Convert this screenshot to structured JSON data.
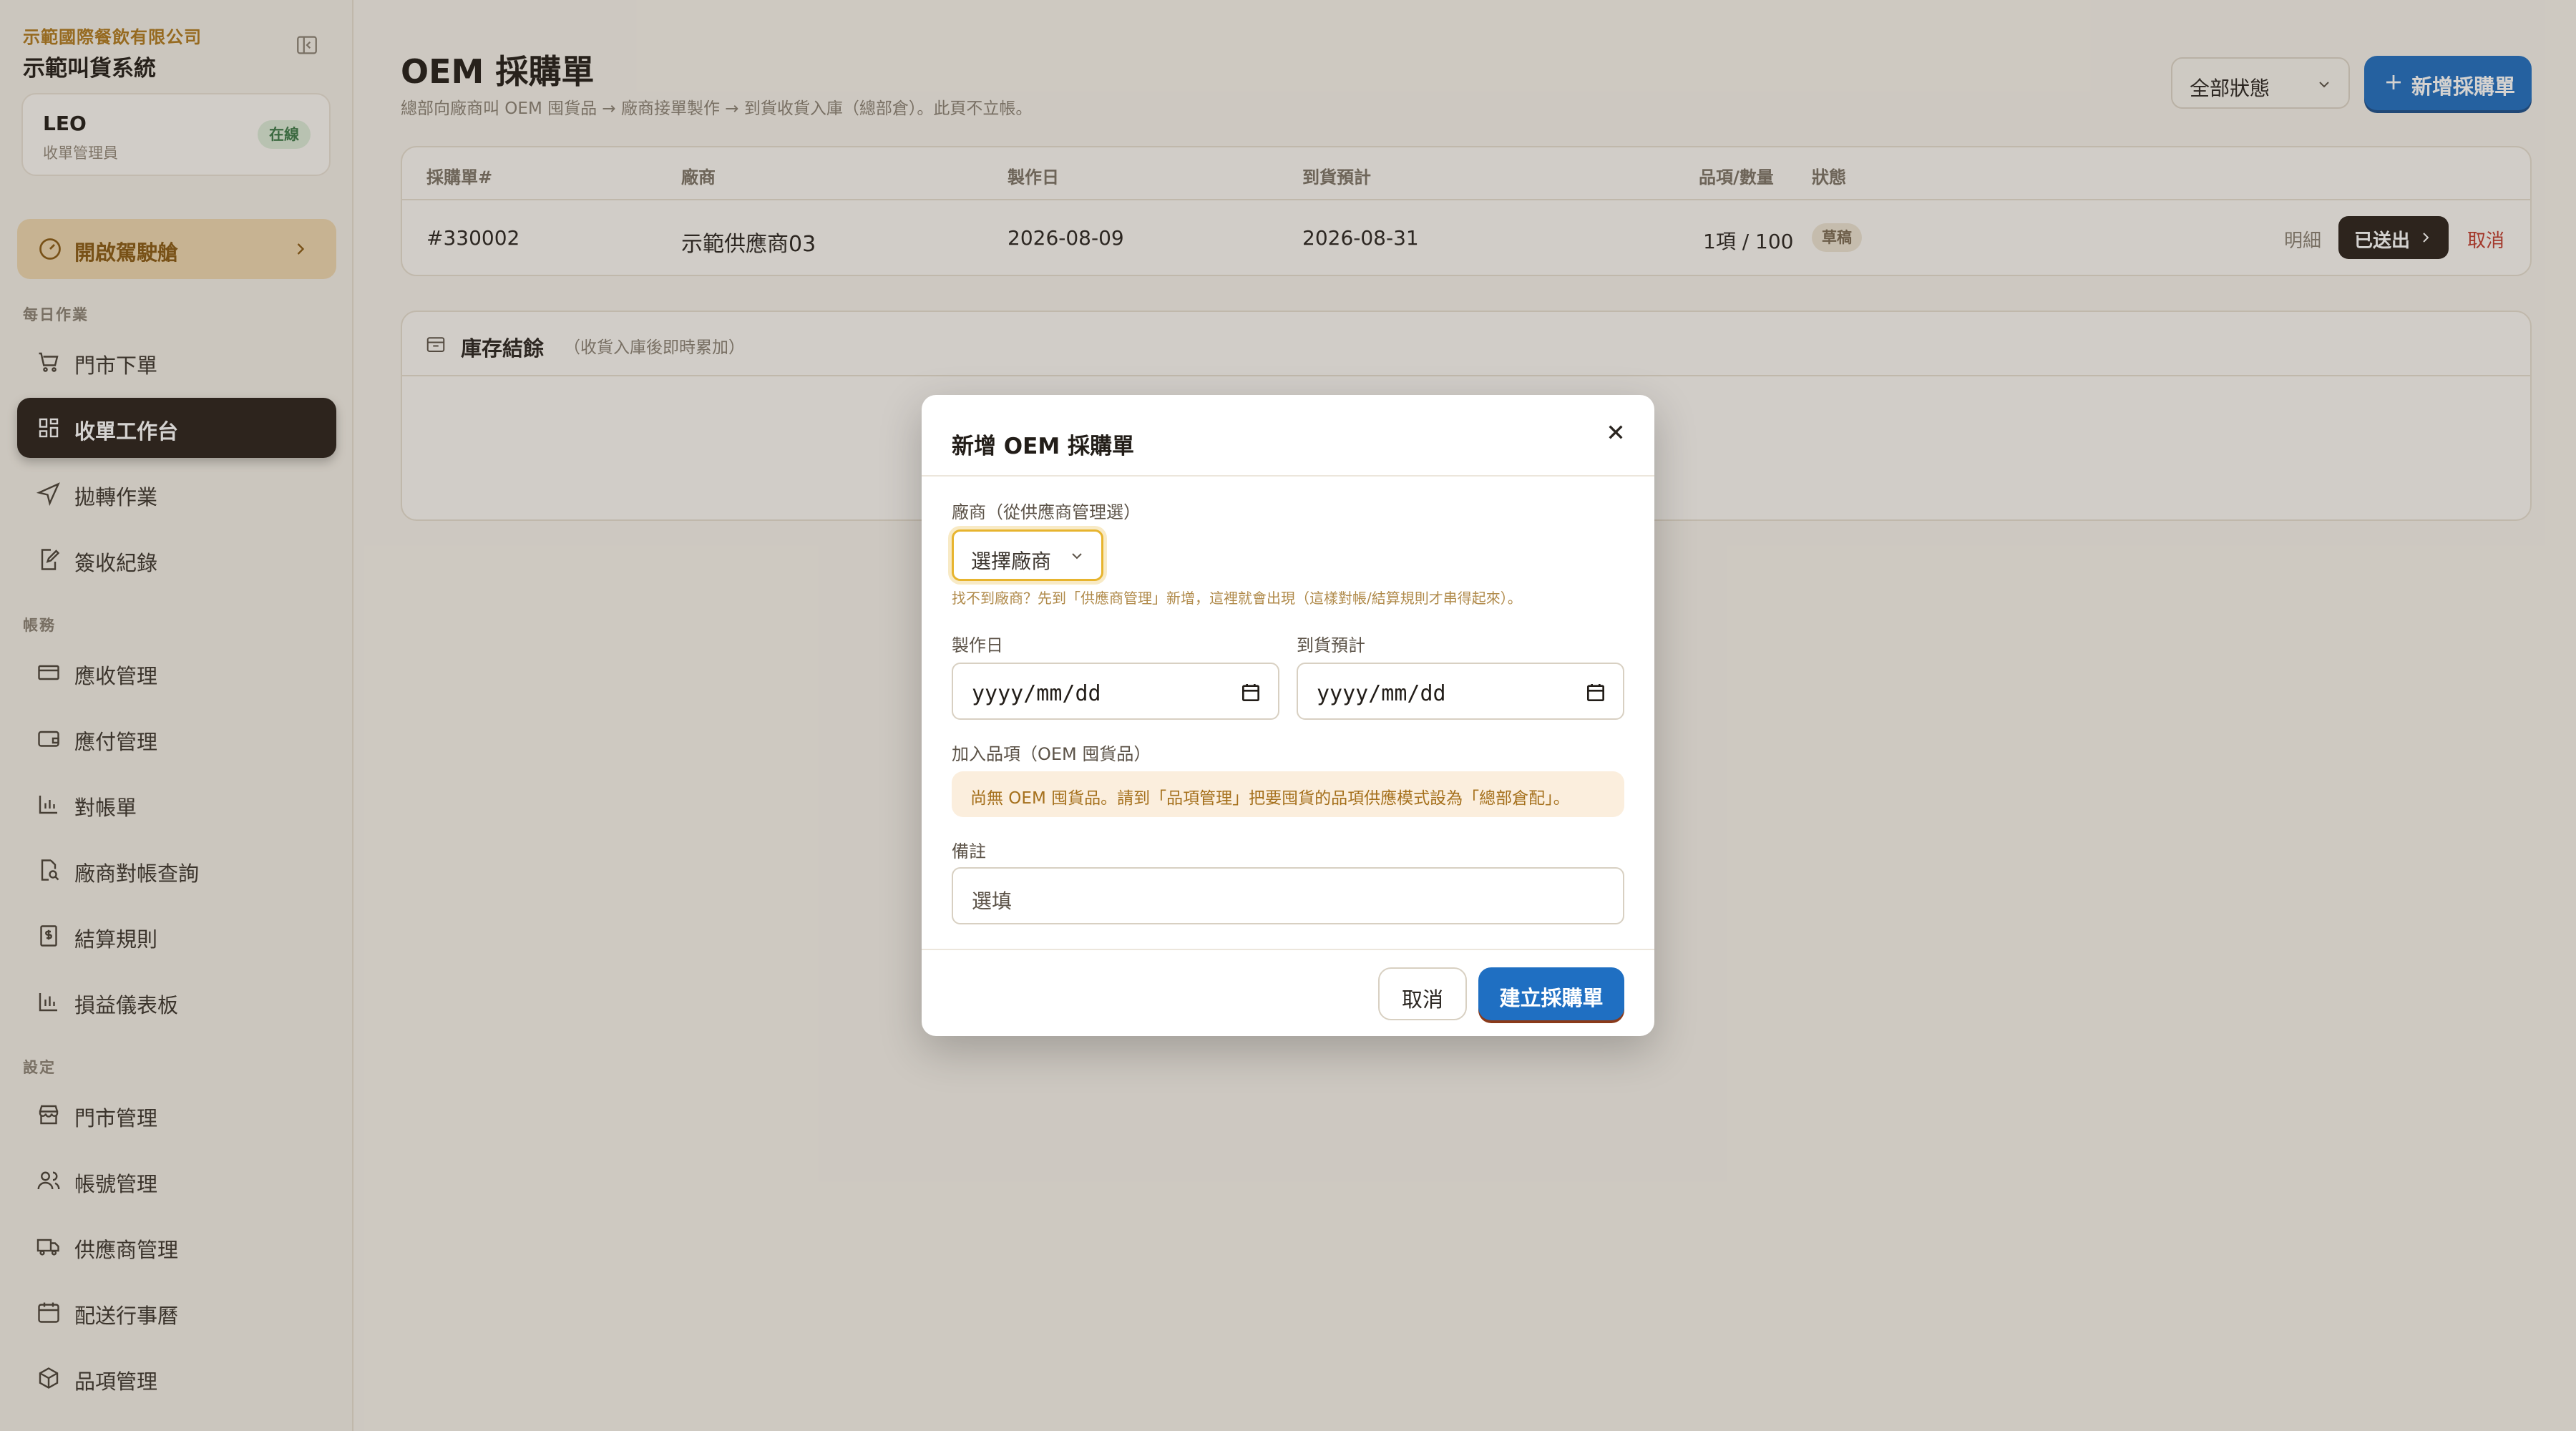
{
  "sidebar": {
    "company": "示範國際餐飲有限公司",
    "system_name": "示範叫貨系統",
    "user": {
      "name": "LEO",
      "role": "收單管理員",
      "status": "在線"
    },
    "driver_button": "開啟駕駛艙",
    "sections": {
      "daily": "每日作業",
      "accounts": "帳務",
      "settings": "設定"
    },
    "items": [
      {
        "label": "門市下單",
        "icon": "cart-icon"
      },
      {
        "label": "收單工作台",
        "icon": "grid-icon",
        "active": true
      },
      {
        "label": "拋轉作業",
        "icon": "send-icon"
      },
      {
        "label": "簽收紀錄",
        "icon": "edit-icon"
      },
      {
        "label": "應收管理",
        "icon": "card-icon"
      },
      {
        "label": "應付管理",
        "icon": "wallet-icon"
      },
      {
        "label": "對帳單",
        "icon": "bar-chart-icon"
      },
      {
        "label": "廠商對帳查詢",
        "icon": "file-search-icon"
      },
      {
        "label": "結算規則",
        "icon": "receipt-icon"
      },
      {
        "label": "損益儀表板",
        "icon": "bar-chart-icon"
      },
      {
        "label": "門市管理",
        "icon": "store-icon"
      },
      {
        "label": "帳號管理",
        "icon": "users-icon"
      },
      {
        "label": "供應商管理",
        "icon": "truck-icon"
      },
      {
        "label": "配送行事曆",
        "icon": "calendar-icon"
      },
      {
        "label": "品項管理",
        "icon": "package-icon"
      }
    ]
  },
  "header": {
    "title": "OEM 採購單",
    "subtitle": "總部向廠商叫 OEM 囤貨品 → 廠商接單製作 → 到貨收貨入庫（總部倉）。此頁不立帳。",
    "status_filter": "全部狀態",
    "new_button": "新增採購單"
  },
  "table": {
    "columns": [
      "採購單#",
      "廠商",
      "製作日",
      "到貨預計",
      "品項/數量",
      "狀態"
    ],
    "rows": [
      {
        "po": "#330002",
        "supplier": "示範供應商03",
        "made": "2026-08-09",
        "eta": "2026-08-31",
        "qty": "1項 / 100",
        "status": "草稿"
      }
    ],
    "actions": {
      "detail": "明細",
      "sent": "已送出",
      "cancel": "取消"
    }
  },
  "inventory": {
    "title": "庫存結餘",
    "hint": "（收貨入庫後即時累加）"
  },
  "modal": {
    "title": "新增 OEM 採購單",
    "supplier_label": "廠商（從供應商管理選）",
    "supplier_value": "選擇廠商",
    "supplier_hint": "找不到廠商？先到「供應商管理」新增，這裡就會出現（這樣對帳/結算規則才串得起來）。",
    "made_label": "製作日",
    "eta_label": "到貨預計",
    "made_value": "yyyy/mm/dd",
    "eta_value": "yyyy/mm/dd",
    "items_label": "加入品項（OEM 囤貨品）",
    "items_notice": "尚無 OEM 囤貨品。請到「品項管理」把要囤貨的品項供應模式設為「總部倉配」。",
    "notes_label": "備註",
    "notes_placeholder": "選填",
    "cancel": "取消",
    "create": "建立採購單"
  },
  "colors": {
    "accent": "#1f6fc2",
    "brand": "#b07a1e",
    "active_nav": "#2a211a",
    "danger": "#c0392b"
  }
}
